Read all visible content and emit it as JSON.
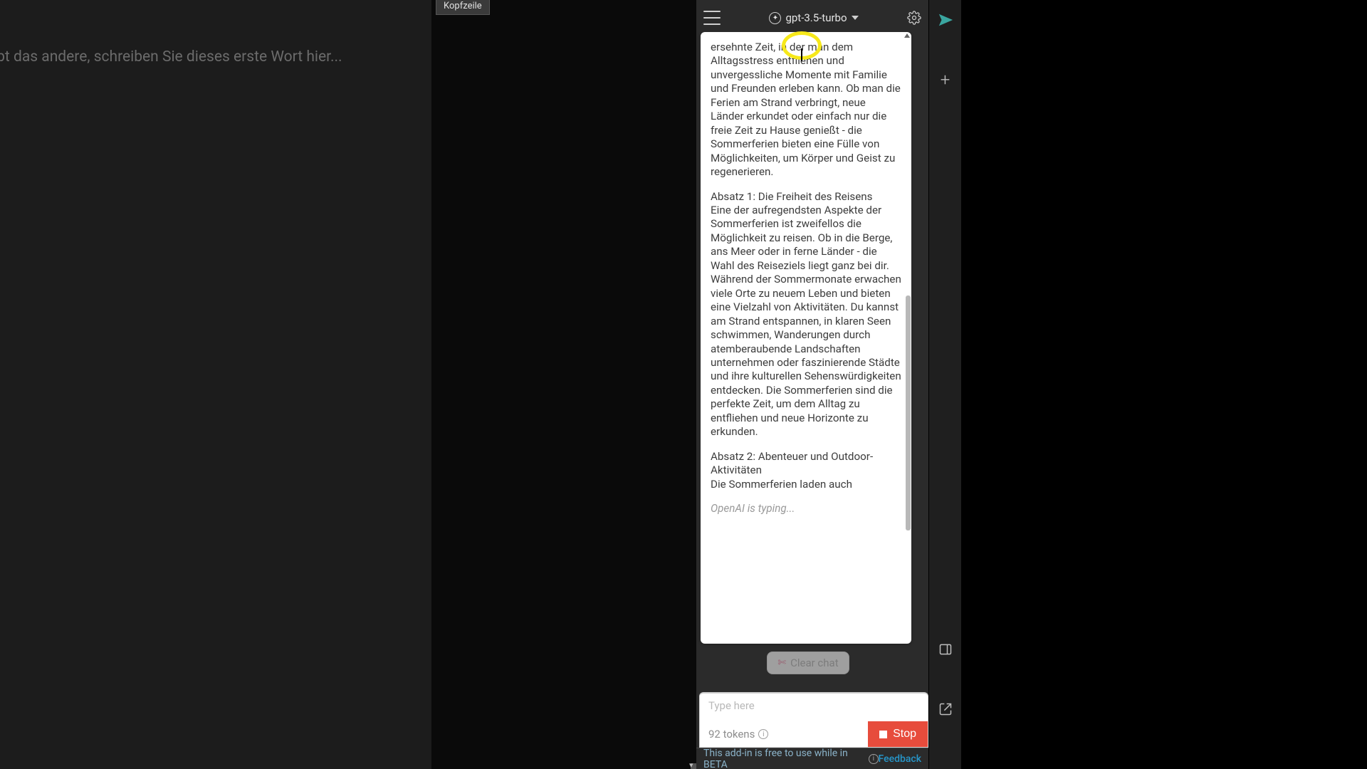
{
  "doc": {
    "header_label": "Kopfzeile",
    "placeholder": "ibt das andere, schreiben Sie dieses erste Wort hier..."
  },
  "panel": {
    "model": "gpt-3.5-turbo"
  },
  "message": {
    "p1": "ersehnte Zeit, in der man dem Alltagsstress entfliehen und unvergessliche Momente mit Familie und Freunden erleben kann. Ob man die Ferien am Strand verbringt, neue Länder erkundet oder einfach nur die freie Zeit zu Hause genießt - die Sommerferien bieten eine Fülle von Möglichkeiten, um Körper und Geist zu regenerieren.",
    "p2": "Absatz 1: Die Freiheit des Reisens\nEine der aufregendsten Aspekte der Sommerferien ist zweifellos die Möglichkeit zu reisen. Ob in die Berge, ans Meer oder in ferne Länder - die Wahl des Reiseziels liegt ganz bei dir. Während der Sommermonate erwachen viele Orte zu neuem Leben und bieten eine Vielzahl von Aktivitäten. Du kannst am Strand entspannen, in klaren Seen schwimmen, Wanderungen durch atemberaubende Landschaften unternehmen oder faszinierende Städte und ihre kulturellen Sehenswürdigkeiten entdecken. Die Sommerferien sind die perfekte Zeit, um dem Alltag zu entfliehen und neue Horizonte zu erkunden.",
    "p3": "Absatz 2: Abenteuer und Outdoor-Aktivitäten\nDie Sommerferien laden auch",
    "typing": "OpenAI is typing..."
  },
  "controls": {
    "clear_chat": "Clear chat",
    "input_placeholder": "Type here",
    "tokens_text": "92 tokens",
    "stop_label": "Stop"
  },
  "footer": {
    "beta_msg": "This add-in is free to use while in BETA",
    "feedback": "Feedback"
  }
}
